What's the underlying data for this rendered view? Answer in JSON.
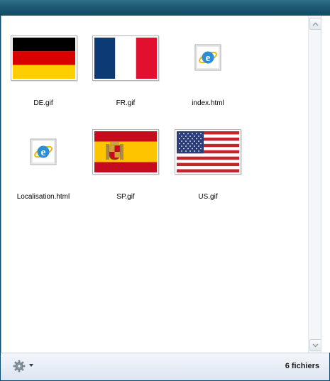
{
  "files": [
    {
      "name": "DE.gif",
      "icon": "germany-flag-icon"
    },
    {
      "name": "FR.gif",
      "icon": "france-flag-icon"
    },
    {
      "name": "index.html",
      "icon": "internet-explorer-html-icon"
    },
    {
      "name": "Localisation.html",
      "icon": "internet-explorer-html-icon"
    },
    {
      "name": "SP.gif",
      "icon": "spain-flag-icon"
    },
    {
      "name": "US.gif",
      "icon": "usa-flag-icon"
    }
  ],
  "status": {
    "item_count": "6 fichiers"
  },
  "colors": {
    "title_bar": "#1d5a72",
    "status_bar": "#e6ecf5"
  }
}
